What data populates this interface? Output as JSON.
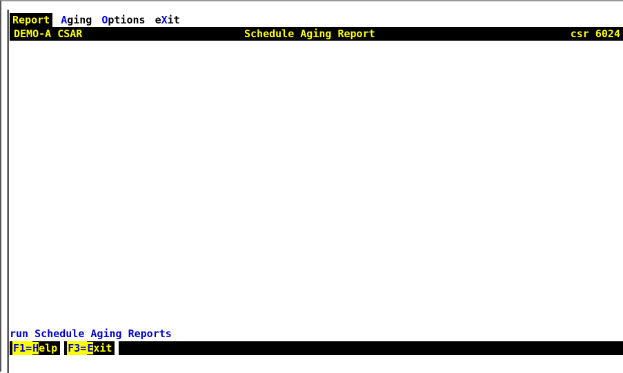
{
  "menubar": {
    "items": [
      {
        "id": "report",
        "hot": "R",
        "rest": "eport",
        "active": true
      },
      {
        "id": "aging",
        "hot": "A",
        "rest": "ging",
        "active": false
      },
      {
        "id": "options",
        "hot": "O",
        "rest": "ptions",
        "active": false
      },
      {
        "id": "exit",
        "pre": "e",
        "hot": "X",
        "rest": "it",
        "active": false
      }
    ]
  },
  "titlebar": {
    "company": "DEMO-A CSAR",
    "title": "Schedule Aging Report",
    "program": "csr 6024"
  },
  "status": {
    "message": "run Schedule Aging Reports"
  },
  "fkeys": [
    {
      "code": "F1",
      "sep": "=",
      "hot": "H",
      "rest": "elp"
    },
    {
      "code": "F3",
      "sep": "=",
      "hot": "E",
      "rest": "xit"
    }
  ],
  "colors": {
    "bar_background": "#000000",
    "bar_text": "#ffff00",
    "hotkey": "#0000ee",
    "status_text": "#0000cc"
  }
}
